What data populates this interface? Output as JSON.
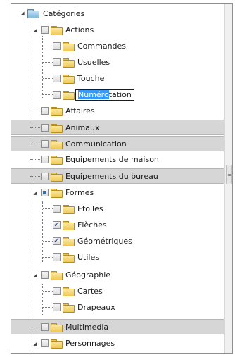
{
  "tree": {
    "root": {
      "label": "Catégories"
    },
    "items": [
      {
        "label": "Actions"
      },
      {
        "label": "Commandes"
      },
      {
        "label": "Usuelles"
      },
      {
        "label": "Touche"
      },
      {
        "label": "Numérotation",
        "edit_selected": "Numéro",
        "edit_rest": "tation"
      },
      {
        "label": "Affaires"
      },
      {
        "label": "Animaux"
      },
      {
        "label": "Communication"
      },
      {
        "label": "Equipements de maison"
      },
      {
        "label": "Equipements du bureau"
      },
      {
        "label": "Formes"
      },
      {
        "label": "Etoiles"
      },
      {
        "label": "Flèches"
      },
      {
        "label": "Géométriques"
      },
      {
        "label": "Utiles"
      },
      {
        "label": "Géographie"
      },
      {
        "label": "Cartes"
      },
      {
        "label": "Drapeaux"
      },
      {
        "label": "Multimedia"
      },
      {
        "label": "Personnages"
      }
    ]
  },
  "colors": {
    "highlight_row": "#d6d6d6",
    "selection": "#3399ff",
    "folder": "#efc955"
  }
}
